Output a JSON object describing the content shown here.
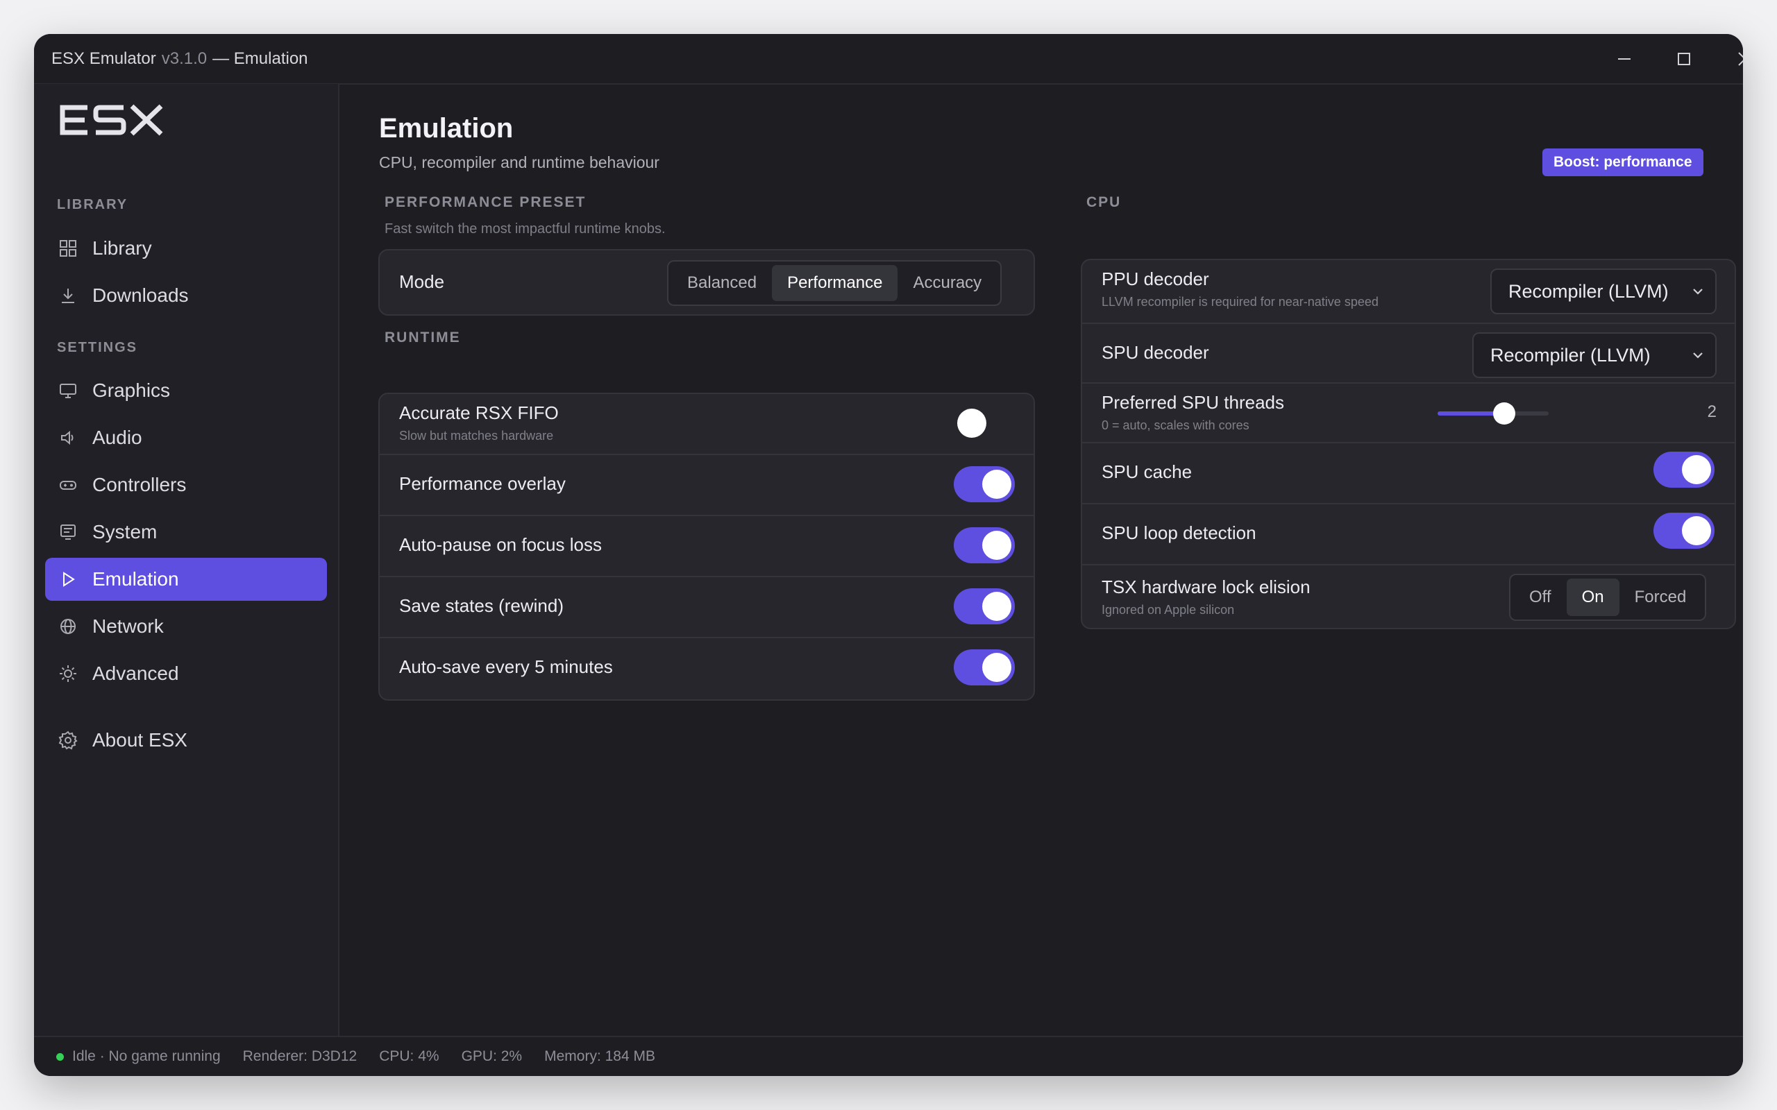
{
  "window": {
    "app_name": "ESX Emulator",
    "version": "v3.1.0",
    "section": "— Emulation"
  },
  "sidebar": {
    "logo": "ESX",
    "library_label": "LIBRARY",
    "library_items": [
      {
        "label": "Library",
        "icon": "grid-icon"
      },
      {
        "label": "Downloads",
        "icon": "download-icon"
      }
    ],
    "settings_label": "SETTINGS",
    "settings_items": [
      {
        "label": "Graphics",
        "icon": "monitor-icon"
      },
      {
        "label": "Audio",
        "icon": "speaker-icon"
      },
      {
        "label": "Controllers",
        "icon": "gamepad-icon"
      },
      {
        "label": "System",
        "icon": "system-icon"
      },
      {
        "label": "Emulation",
        "icon": "play-icon",
        "active": true
      },
      {
        "label": "Network",
        "icon": "globe-icon"
      },
      {
        "label": "Advanced",
        "icon": "sun-icon"
      }
    ],
    "about": {
      "label": "About ESX",
      "icon": "gear-icon"
    }
  },
  "main": {
    "title": "Emulation",
    "subtitle": "CPU, recompiler and runtime behaviour",
    "boost_badge": "Boost: performance",
    "preset": {
      "label": "PERFORMANCE PRESET",
      "hint": "Fast switch the most impactful runtime knobs.",
      "mode_label": "Mode",
      "options": [
        "Balanced",
        "Performance",
        "Accuracy"
      ],
      "selected": "Performance"
    },
    "runtime": {
      "label": "RUNTIME",
      "rows": [
        {
          "label": "Accurate RSX FIFO",
          "sub": "Slow but matches hardware",
          "on": false
        },
        {
          "label": "Performance overlay",
          "sub": "",
          "on": true
        },
        {
          "label": "Auto-pause on focus loss",
          "sub": "",
          "on": true
        },
        {
          "label": "Save states (rewind)",
          "sub": "",
          "on": true
        },
        {
          "label": "Auto-save every 5 minutes",
          "sub": "",
          "on": true
        }
      ]
    },
    "cpu": {
      "label": "CPU",
      "ppu_decoder": {
        "label": "PPU decoder",
        "sub": "LLVM recompiler is required for near-native speed",
        "value": "Recompiler (LLVM)"
      },
      "spu_decoder": {
        "label": "SPU decoder",
        "value": "Recompiler (LLVM)"
      },
      "spu_threads": {
        "label": "Preferred SPU threads",
        "sub": "0 = auto, scales with cores",
        "value": "2",
        "level": 0.6
      },
      "spu_cache": {
        "label": "SPU cache",
        "on": true
      },
      "spu_loop": {
        "label": "SPU loop detection",
        "on": true
      },
      "tsx": {
        "label": "TSX hardware lock elision",
        "sub": "Ignored on Apple silicon",
        "options": [
          "Off",
          "On",
          "Forced"
        ],
        "selected": "On"
      }
    }
  },
  "status": {
    "state": "Idle · No game running",
    "renderer": "Renderer: D3D12",
    "cpu": "CPU: 4%",
    "gpu": "GPU: 2%",
    "memory": "Memory: 184 MB"
  },
  "colors": {
    "accent": "#5f4fe0",
    "status_ok": "#34d058"
  }
}
